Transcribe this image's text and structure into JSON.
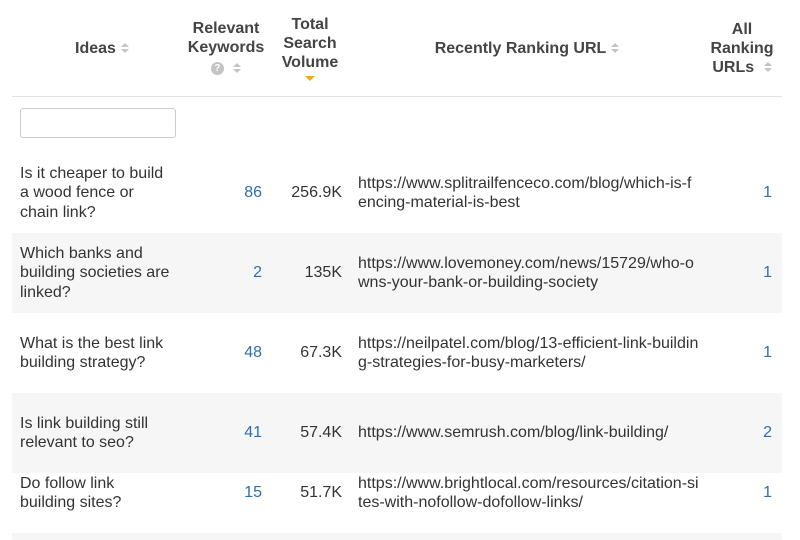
{
  "columns": {
    "ideas": "Ideas",
    "relevant_keywords": "Relevant Keywords",
    "total_search_volume": "Total Search Volume",
    "recently_ranking_url": "Recently Ranking URL",
    "all_ranking_urls": "All Ranking URLs"
  },
  "help_glyph": "?",
  "filter": {
    "placeholder": "",
    "value": ""
  },
  "accent_colors": {
    "link": "#2b6fb3",
    "active_sort": "#f5a623"
  },
  "rows": [
    {
      "idea": "Is it cheaper to build a wood fence or chain link?",
      "keywords": "86",
      "volume": "256.9K",
      "url": "https://www.splitrailfenceco.com/blog/which-is-fencing-material-is-best",
      "all_urls": "1"
    },
    {
      "idea": "Which banks and building societies are linked?",
      "keywords": "2",
      "volume": "135K",
      "url": "https://www.lovemoney.com/news/15729/who-owns-your-bank-or-building-society",
      "all_urls": "1"
    },
    {
      "idea": "What is the best link building strategy?",
      "keywords": "48",
      "volume": "67.3K",
      "url": "https://neilpatel.com/blog/13-efficient-link-building-strategies-for-busy-marketers/",
      "all_urls": "1"
    },
    {
      "idea": "Is link building still relevant to seo?",
      "keywords": "41",
      "volume": "57.4K",
      "url": "https://www.semrush.com/blog/link-building/",
      "all_urls": "2"
    },
    {
      "idea": "Do follow link building sites?",
      "keywords": "15",
      "volume": "51.7K",
      "url": "https://www.brightlocal.com/resources/citation-sites-with-nofollow-dofollow-links/",
      "all_urls": "1"
    }
  ]
}
